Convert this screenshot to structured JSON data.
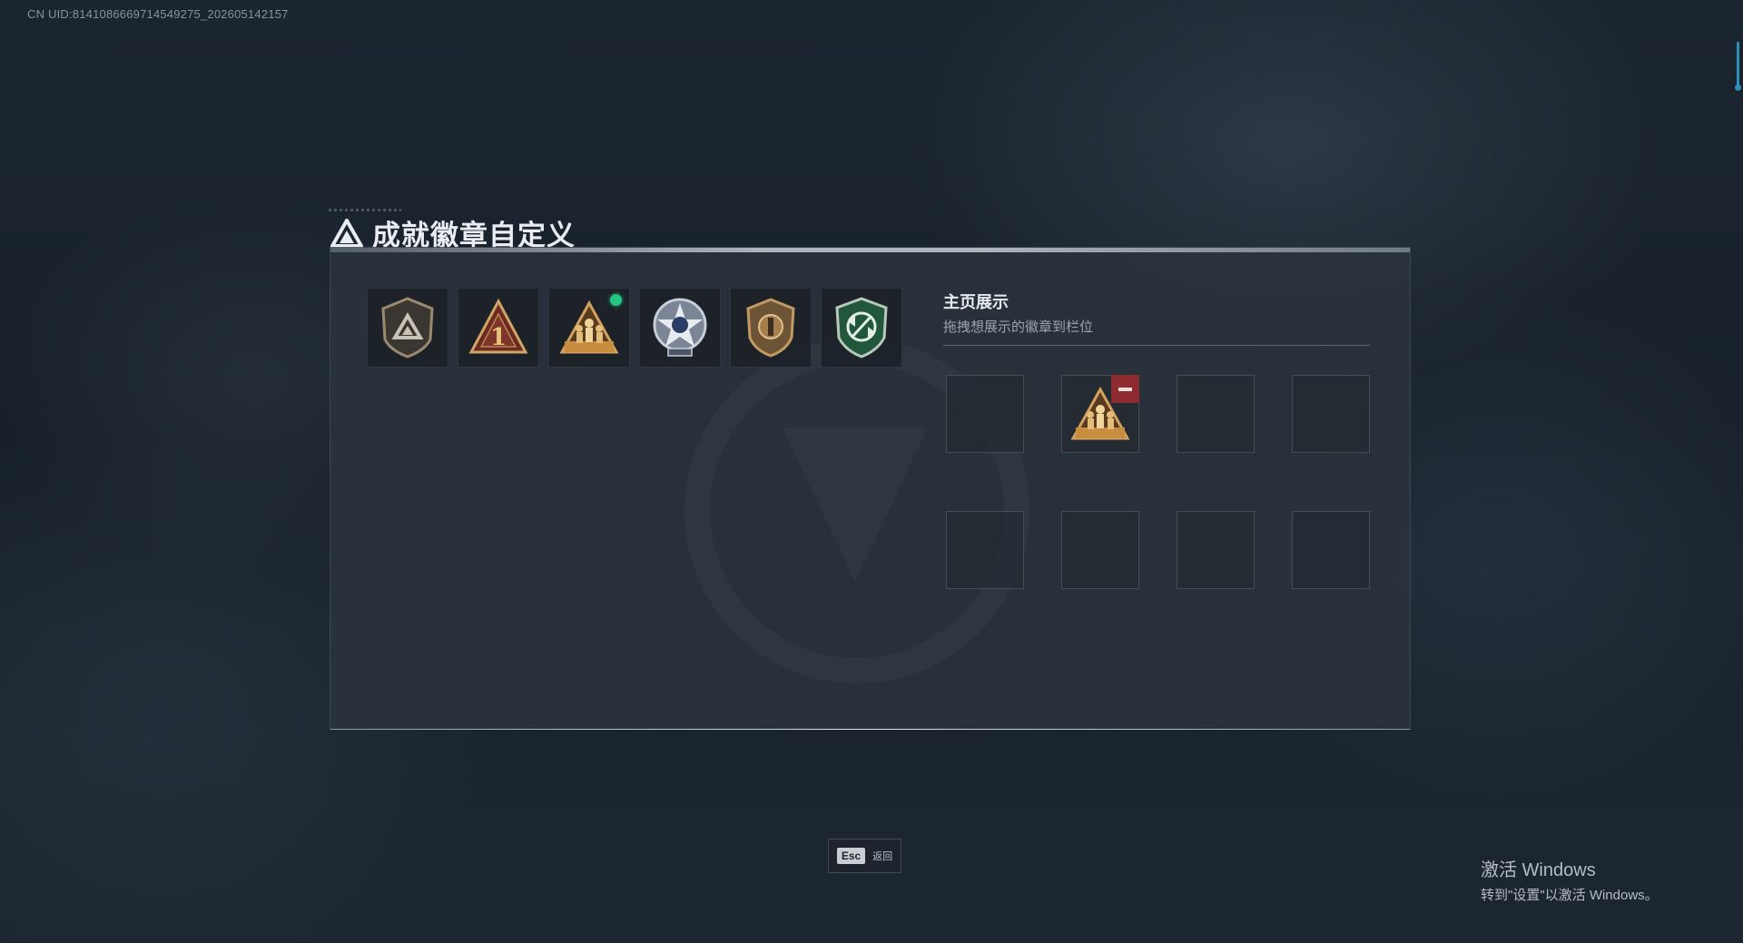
{
  "uid_text": "CN UID:8141086669714549275_202605142157",
  "title": "成就徽章自定义",
  "badge_list": [
    {
      "name": "shield-triangle-badge",
      "selected": false
    },
    {
      "name": "triangle-one-badge",
      "selected": false
    },
    {
      "name": "squad-triangle-badge",
      "selected": true
    },
    {
      "name": "star-wheel-badge",
      "selected": false
    },
    {
      "name": "bronze-shield-badge",
      "selected": false
    },
    {
      "name": "green-shield-arrows-badge",
      "selected": false
    }
  ],
  "display": {
    "title": "主页展示",
    "subtitle": "拖拽想展示的徽章到栏位",
    "slots": [
      {
        "badge": null
      },
      {
        "badge": "squad-triangle-badge",
        "removable": true
      },
      {
        "badge": null
      },
      {
        "badge": null
      },
      {
        "badge": null
      },
      {
        "badge": null
      },
      {
        "badge": null
      },
      {
        "badge": null
      }
    ]
  },
  "esc": {
    "key": "Esc",
    "label": "返回"
  },
  "windows_activation": {
    "line1": "激活 Windows",
    "line2": "转到\"设置\"以激活 Windows。"
  },
  "colors": {
    "accent_green": "#25c684",
    "remove_red": "#8e2b2f",
    "scroll_blue": "#2e90b8"
  }
}
